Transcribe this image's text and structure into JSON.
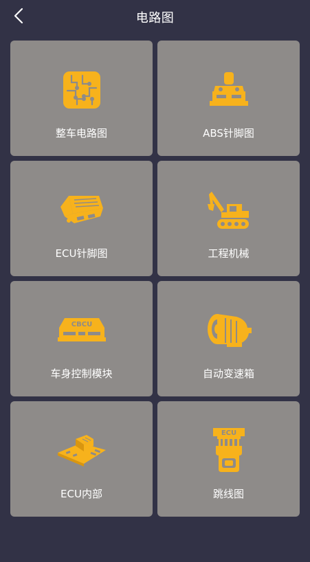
{
  "header": {
    "title": "电路图",
    "back_icon": "chevron-left-icon"
  },
  "colors": {
    "background": "#323246",
    "card": "#8e8b89",
    "icon": "#f7b21c",
    "text": "#ffffff"
  },
  "cards": [
    {
      "label": "整车电路图",
      "icon": "circuit-board-icon"
    },
    {
      "label": "ABS针脚图",
      "icon": "abs-pump-icon"
    },
    {
      "label": "ECU针脚图",
      "icon": "ecu-module-icon"
    },
    {
      "label": "工程机械",
      "icon": "excavator-icon"
    },
    {
      "label": "车身控制模块",
      "icon": "cbcu-module-icon"
    },
    {
      "label": "自动变速箱",
      "icon": "transmission-icon"
    },
    {
      "label": "ECU内部",
      "icon": "ecu-internal-board-icon"
    },
    {
      "label": "跳线图",
      "icon": "ecu-jumper-icon"
    }
  ]
}
